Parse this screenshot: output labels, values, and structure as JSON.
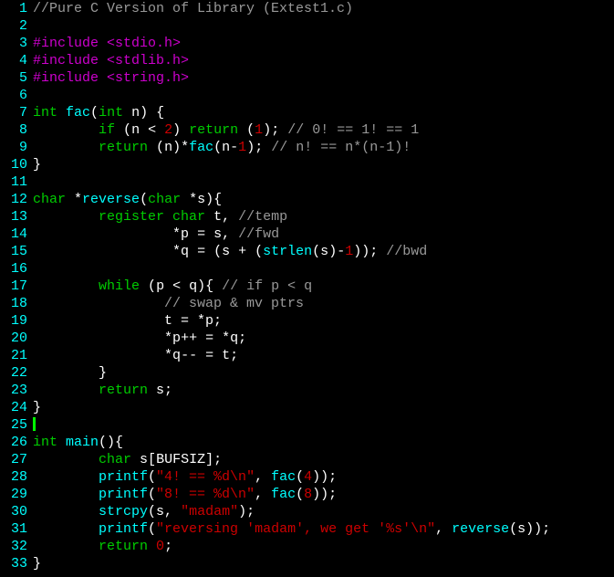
{
  "lines": [
    {
      "num": "1",
      "tokens": [
        {
          "c": "comment",
          "t": "//Pure C Version of Library (Extest1.c)"
        }
      ]
    },
    {
      "num": "2",
      "tokens": []
    },
    {
      "num": "3",
      "tokens": [
        {
          "c": "preproc",
          "t": "#include "
        },
        {
          "c": "incfile",
          "t": "<stdio.h>"
        }
      ]
    },
    {
      "num": "4",
      "tokens": [
        {
          "c": "preproc",
          "t": "#include "
        },
        {
          "c": "incfile",
          "t": "<stdlib.h>"
        }
      ]
    },
    {
      "num": "5",
      "tokens": [
        {
          "c": "preproc",
          "t": "#include "
        },
        {
          "c": "incfile",
          "t": "<string.h>"
        }
      ]
    },
    {
      "num": "6",
      "tokens": []
    },
    {
      "num": "7",
      "tokens": [
        {
          "c": "type",
          "t": "int"
        },
        {
          "c": "ident",
          "t": " "
        },
        {
          "c": "func",
          "t": "fac"
        },
        {
          "c": "paren",
          "t": "("
        },
        {
          "c": "type",
          "t": "int"
        },
        {
          "c": "ident",
          "t": " n"
        },
        {
          "c": "paren",
          "t": ") {"
        }
      ]
    },
    {
      "num": "8",
      "tokens": [
        {
          "c": "ident",
          "t": "        "
        },
        {
          "c": "keyword",
          "t": "if"
        },
        {
          "c": "ident",
          "t": " "
        },
        {
          "c": "paren",
          "t": "("
        },
        {
          "c": "ident",
          "t": "n "
        },
        {
          "c": "op",
          "t": "< "
        },
        {
          "c": "num",
          "t": "2"
        },
        {
          "c": "paren",
          "t": ") "
        },
        {
          "c": "keyword",
          "t": "return"
        },
        {
          "c": "ident",
          "t": " "
        },
        {
          "c": "paren",
          "t": "("
        },
        {
          "c": "num",
          "t": "1"
        },
        {
          "c": "paren",
          "t": "); "
        },
        {
          "c": "comment",
          "t": "// 0! == 1! == 1"
        }
      ]
    },
    {
      "num": "9",
      "tokens": [
        {
          "c": "ident",
          "t": "        "
        },
        {
          "c": "keyword",
          "t": "return"
        },
        {
          "c": "ident",
          "t": " "
        },
        {
          "c": "paren",
          "t": "("
        },
        {
          "c": "ident",
          "t": "n"
        },
        {
          "c": "paren",
          "t": ")"
        },
        {
          "c": "op",
          "t": "*"
        },
        {
          "c": "func",
          "t": "fac"
        },
        {
          "c": "paren",
          "t": "("
        },
        {
          "c": "ident",
          "t": "n"
        },
        {
          "c": "op",
          "t": "-"
        },
        {
          "c": "num",
          "t": "1"
        },
        {
          "c": "paren",
          "t": "); "
        },
        {
          "c": "comment",
          "t": "// n! == n*(n-1)!"
        }
      ]
    },
    {
      "num": "10",
      "tokens": [
        {
          "c": "paren",
          "t": "}"
        }
      ]
    },
    {
      "num": "11",
      "tokens": []
    },
    {
      "num": "12",
      "tokens": [
        {
          "c": "type",
          "t": "char"
        },
        {
          "c": "ident",
          "t": " "
        },
        {
          "c": "op",
          "t": "*"
        },
        {
          "c": "func",
          "t": "reverse"
        },
        {
          "c": "paren",
          "t": "("
        },
        {
          "c": "type",
          "t": "char"
        },
        {
          "c": "ident",
          "t": " "
        },
        {
          "c": "op",
          "t": "*"
        },
        {
          "c": "ident",
          "t": "s"
        },
        {
          "c": "paren",
          "t": "){"
        }
      ]
    },
    {
      "num": "13",
      "tokens": [
        {
          "c": "ident",
          "t": "        "
        },
        {
          "c": "keyword",
          "t": "register"
        },
        {
          "c": "ident",
          "t": " "
        },
        {
          "c": "type",
          "t": "char"
        },
        {
          "c": "ident",
          "t": " t, "
        },
        {
          "c": "comment",
          "t": "//temp"
        }
      ]
    },
    {
      "num": "14",
      "tokens": [
        {
          "c": "ident",
          "t": "                 "
        },
        {
          "c": "op",
          "t": "*"
        },
        {
          "c": "ident",
          "t": "p "
        },
        {
          "c": "op",
          "t": "= "
        },
        {
          "c": "ident",
          "t": "s, "
        },
        {
          "c": "comment",
          "t": "//fwd"
        }
      ]
    },
    {
      "num": "15",
      "tokens": [
        {
          "c": "ident",
          "t": "                 "
        },
        {
          "c": "op",
          "t": "*"
        },
        {
          "c": "ident",
          "t": "q "
        },
        {
          "c": "op",
          "t": "= "
        },
        {
          "c": "paren",
          "t": "("
        },
        {
          "c": "ident",
          "t": "s "
        },
        {
          "c": "op",
          "t": "+ "
        },
        {
          "c": "paren",
          "t": "("
        },
        {
          "c": "func",
          "t": "strlen"
        },
        {
          "c": "paren",
          "t": "("
        },
        {
          "c": "ident",
          "t": "s"
        },
        {
          "c": "paren",
          "t": ")"
        },
        {
          "c": "op",
          "t": "-"
        },
        {
          "c": "num",
          "t": "1"
        },
        {
          "c": "paren",
          "t": ")); "
        },
        {
          "c": "comment",
          "t": "//bwd"
        }
      ]
    },
    {
      "num": "16",
      "tokens": []
    },
    {
      "num": "17",
      "tokens": [
        {
          "c": "ident",
          "t": "        "
        },
        {
          "c": "keyword",
          "t": "while"
        },
        {
          "c": "ident",
          "t": " "
        },
        {
          "c": "paren",
          "t": "("
        },
        {
          "c": "ident",
          "t": "p "
        },
        {
          "c": "op",
          "t": "< "
        },
        {
          "c": "ident",
          "t": "q"
        },
        {
          "c": "paren",
          "t": "){ "
        },
        {
          "c": "comment",
          "t": "// if p < q"
        }
      ]
    },
    {
      "num": "18",
      "tokens": [
        {
          "c": "ident",
          "t": "                "
        },
        {
          "c": "comment",
          "t": "// swap & mv ptrs"
        }
      ]
    },
    {
      "num": "19",
      "tokens": [
        {
          "c": "ident",
          "t": "                t "
        },
        {
          "c": "op",
          "t": "= *"
        },
        {
          "c": "ident",
          "t": "p;"
        }
      ]
    },
    {
      "num": "20",
      "tokens": [
        {
          "c": "ident",
          "t": "                "
        },
        {
          "c": "op",
          "t": "*"
        },
        {
          "c": "ident",
          "t": "p"
        },
        {
          "c": "op",
          "t": "++ = *"
        },
        {
          "c": "ident",
          "t": "q;"
        }
      ]
    },
    {
      "num": "21",
      "tokens": [
        {
          "c": "ident",
          "t": "                "
        },
        {
          "c": "op",
          "t": "*"
        },
        {
          "c": "ident",
          "t": "q"
        },
        {
          "c": "op",
          "t": "-- = "
        },
        {
          "c": "ident",
          "t": "t;"
        }
      ]
    },
    {
      "num": "22",
      "tokens": [
        {
          "c": "ident",
          "t": "        "
        },
        {
          "c": "paren",
          "t": "}"
        }
      ]
    },
    {
      "num": "23",
      "tokens": [
        {
          "c": "ident",
          "t": "        "
        },
        {
          "c": "keyword",
          "t": "return"
        },
        {
          "c": "ident",
          "t": " s;"
        }
      ]
    },
    {
      "num": "24",
      "tokens": [
        {
          "c": "paren",
          "t": "}"
        }
      ]
    },
    {
      "num": "25",
      "tokens": []
    },
    {
      "num": "26",
      "tokens": [
        {
          "c": "type",
          "t": "int"
        },
        {
          "c": "ident",
          "t": " "
        },
        {
          "c": "func",
          "t": "main"
        },
        {
          "c": "paren",
          "t": "(){"
        }
      ]
    },
    {
      "num": "27",
      "tokens": [
        {
          "c": "ident",
          "t": "        "
        },
        {
          "c": "type",
          "t": "char"
        },
        {
          "c": "ident",
          "t": " s"
        },
        {
          "c": "paren",
          "t": "["
        },
        {
          "c": "const",
          "t": "BUFSIZ"
        },
        {
          "c": "paren",
          "t": "];"
        }
      ]
    },
    {
      "num": "28",
      "tokens": [
        {
          "c": "ident",
          "t": "        "
        },
        {
          "c": "func",
          "t": "printf"
        },
        {
          "c": "paren",
          "t": "("
        },
        {
          "c": "str",
          "t": "\"4! == %d\\n\""
        },
        {
          "c": "ident",
          "t": ", "
        },
        {
          "c": "func",
          "t": "fac"
        },
        {
          "c": "paren",
          "t": "("
        },
        {
          "c": "num",
          "t": "4"
        },
        {
          "c": "paren",
          "t": "));"
        }
      ]
    },
    {
      "num": "29",
      "tokens": [
        {
          "c": "ident",
          "t": "        "
        },
        {
          "c": "func",
          "t": "printf"
        },
        {
          "c": "paren",
          "t": "("
        },
        {
          "c": "str",
          "t": "\"8! == %d\\n\""
        },
        {
          "c": "ident",
          "t": ", "
        },
        {
          "c": "func",
          "t": "fac"
        },
        {
          "c": "paren",
          "t": "("
        },
        {
          "c": "num",
          "t": "8"
        },
        {
          "c": "paren",
          "t": "));"
        }
      ]
    },
    {
      "num": "30",
      "tokens": [
        {
          "c": "ident",
          "t": "        "
        },
        {
          "c": "func",
          "t": "strcpy"
        },
        {
          "c": "paren",
          "t": "("
        },
        {
          "c": "ident",
          "t": "s, "
        },
        {
          "c": "str",
          "t": "\"madam\""
        },
        {
          "c": "paren",
          "t": ");"
        }
      ]
    },
    {
      "num": "31",
      "tokens": [
        {
          "c": "ident",
          "t": "        "
        },
        {
          "c": "func",
          "t": "printf"
        },
        {
          "c": "paren",
          "t": "("
        },
        {
          "c": "str",
          "t": "\"reversing 'madam', we get '%s'\\n\""
        },
        {
          "c": "ident",
          "t": ", "
        },
        {
          "c": "func",
          "t": "reverse"
        },
        {
          "c": "paren",
          "t": "("
        },
        {
          "c": "ident",
          "t": "s"
        },
        {
          "c": "paren",
          "t": "));"
        }
      ]
    },
    {
      "num": "32",
      "tokens": [
        {
          "c": "ident",
          "t": "        "
        },
        {
          "c": "keyword",
          "t": "return"
        },
        {
          "c": "ident",
          "t": " "
        },
        {
          "c": "num",
          "t": "0"
        },
        {
          "c": "ident",
          "t": ";"
        }
      ]
    },
    {
      "num": "33",
      "tokens": [
        {
          "c": "paren",
          "t": "}"
        }
      ]
    }
  ],
  "cursor_line": 25
}
